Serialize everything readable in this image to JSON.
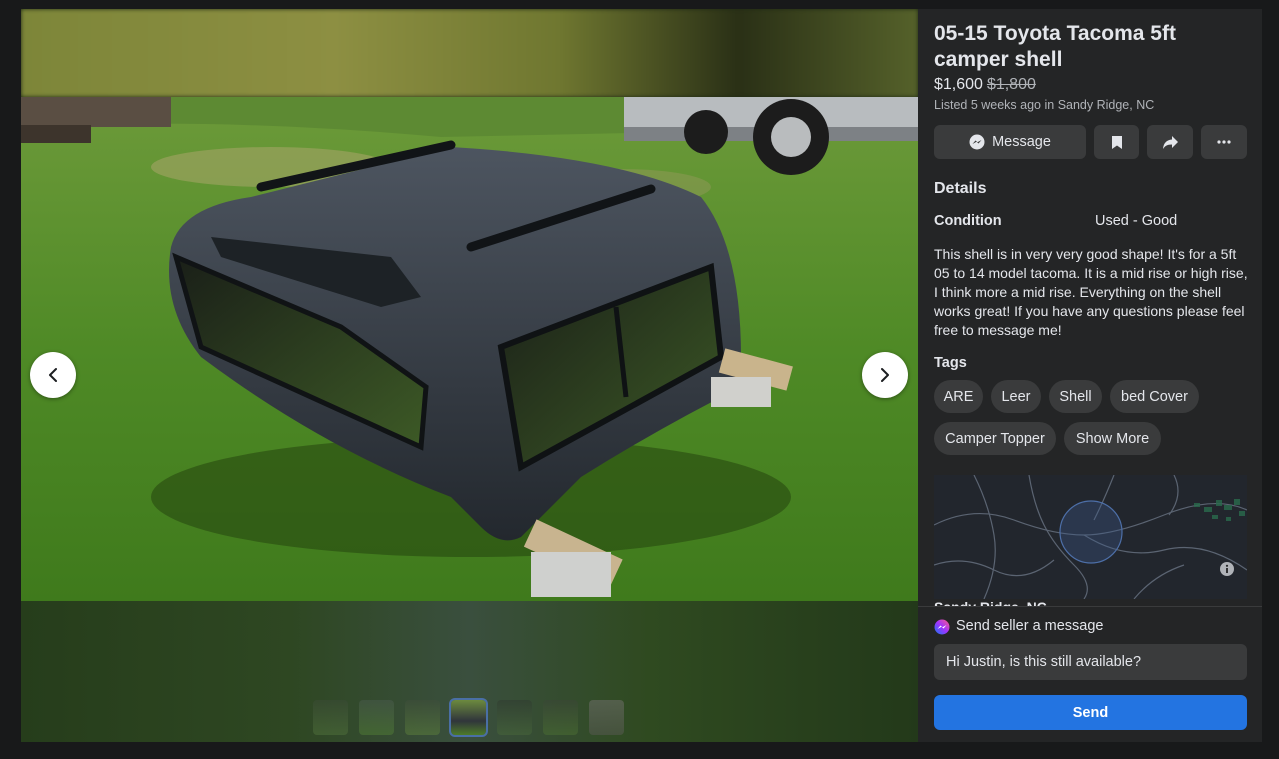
{
  "listing": {
    "title": "05-15 Toyota Tacoma 5ft camper shell",
    "price": "$1,600",
    "original_price": "$1,800",
    "listed": "Listed 5 weeks ago in Sandy Ridge, NC"
  },
  "actions": {
    "message_label": "Message",
    "save_icon": "bookmark-icon",
    "share_icon": "share-icon",
    "more_icon": "more-icon"
  },
  "details": {
    "heading": "Details",
    "condition_label": "Condition",
    "condition_value": "Used - Good",
    "description": "This shell is in very very good shape! It's for a 5ft 05 to 14 model tacoma. It is a mid rise or high rise, I think more a mid rise. Everything on the shell works great! If you have any questions please feel free to message me!"
  },
  "tags": {
    "heading": "Tags",
    "items": [
      "ARE",
      "Leer",
      "Shell",
      "bed Cover",
      "Camper Topper"
    ],
    "show_more": "Show More"
  },
  "location": {
    "caption": "Sandy Ridge, NC"
  },
  "message_box": {
    "label": "Send seller a message",
    "value": "Hi Justin, is this still available?",
    "send_label": "Send"
  },
  "gallery": {
    "thumbnail_count": 7,
    "active_index": 3
  },
  "colors": {
    "accent": "#2374e1",
    "panel": "#242526",
    "button": "#3a3b3c"
  }
}
